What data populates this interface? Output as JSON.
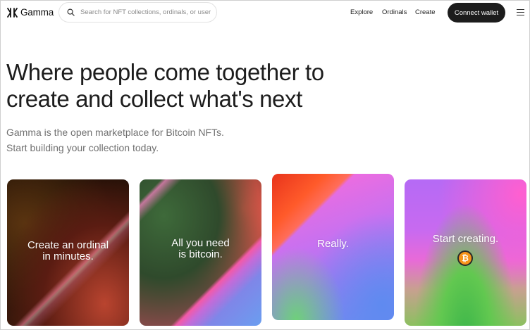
{
  "header": {
    "brand": "Gamma",
    "logo_icon": "gamma-logo-icon",
    "search": {
      "placeholder": "Search for NFT collections, ordinals, or users",
      "value": ""
    },
    "nav": [
      "Explore",
      "Ordinals",
      "Create"
    ],
    "connect_label": "Connect wallet",
    "menu_icon": "hamburger-menu-icon"
  },
  "hero": {
    "title_line1": "Where people come together to",
    "title_line2": "create and collect what's next",
    "sub_line1": "Gamma is the open marketplace for Bitcoin NFTs.",
    "sub_line2": "Start building your collection today."
  },
  "cards": [
    {
      "line1": "Create an ordinal",
      "line2": "in minutes."
    },
    {
      "line1": "All you need",
      "line2": "is bitcoin."
    },
    {
      "line1": "Really.",
      "line2": ""
    },
    {
      "line1": "Start creating.",
      "line2": "",
      "icon": "bitcoin-icon",
      "icon_glyph": "₿"
    }
  ],
  "colors": {
    "accent_button": "#1c1c1c",
    "bitcoin": "#f7931a"
  }
}
